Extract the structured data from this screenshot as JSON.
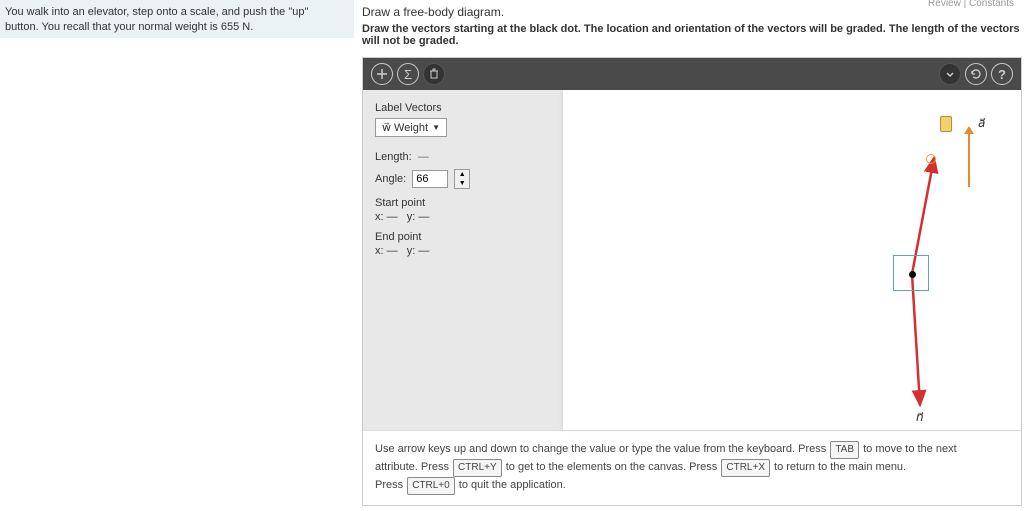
{
  "top_links": "Review | Constants",
  "problem_text": "You walk into an elevator, step onto a scale, and push the \"up\" button. You recall that your normal weight is 655 N.",
  "instruction1": "Draw a free-body diagram.",
  "instruction2": "Draw the vectors starting at the black dot. The location and orientation of the vectors will be graded. The length of the vectors will not be graded.",
  "controls": {
    "label_vectors": "Label Vectors",
    "weight_dropdown": "w⃗  Weight",
    "length_label": "Length:",
    "length_value": "—",
    "angle_label": "Angle:",
    "angle_value": "66",
    "start_point": "Start point",
    "start_x": "x: —",
    "start_y": "y: —",
    "end_point": "End point",
    "end_x": "x: —",
    "end_y": "y: —"
  },
  "labels": {
    "a": "a⃗",
    "n": "n⃗"
  },
  "help": {
    "line1a": "Use arrow keys up and down to change the value or type the value from the keyboard. Press ",
    "tab": "TAB",
    "line1b": " to move to the next",
    "line2a": "attribute. Press ",
    "ctrly": "CTRL+Y",
    "line2b": " to get to the elements on the canvas. Press ",
    "ctrlx": "CTRL+X",
    "line2c": " to return to the main menu.",
    "line3a": "Press ",
    "ctrl0": "CTRL+0",
    "line3b": " to quit the application."
  }
}
